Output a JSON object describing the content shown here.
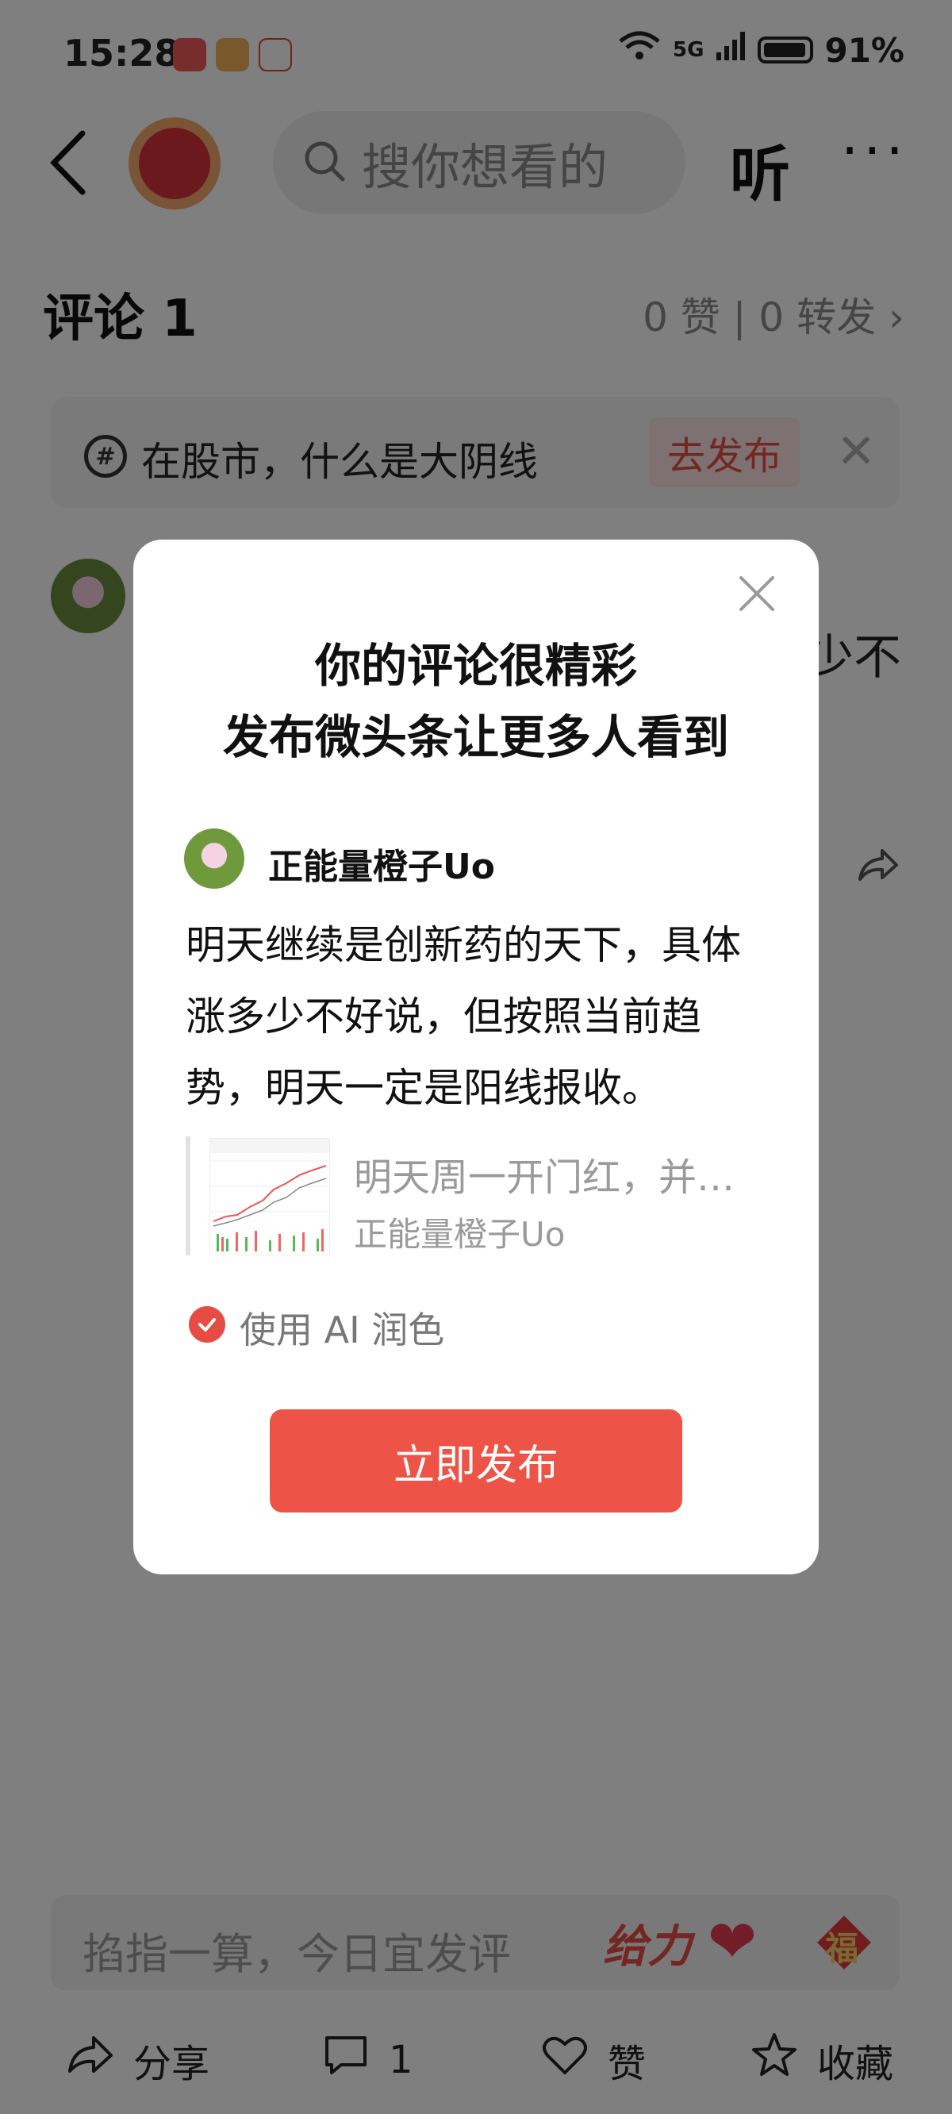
{
  "status_bar": {
    "time": "15:28",
    "network": "5G",
    "battery": "91%"
  },
  "header": {
    "search_placeholder": "搜你想看的",
    "listen_label": "听",
    "more_label": "···"
  },
  "comments": {
    "title": "评论 1",
    "stats": "0 赞 | 0 转发 ›"
  },
  "topic": {
    "text": "在股市，什么是大阴线",
    "publish_label": "去发布",
    "close": "✕"
  },
  "background_comment": {
    "partial_text": "少不"
  },
  "input": {
    "placeholder": "掐指一算，今日宜发评",
    "gift_label": "给力",
    "fu_label": "福"
  },
  "bottom_bar": {
    "share": "分享",
    "comment_count": "1",
    "like": "赞",
    "favorite": "收藏"
  },
  "modal": {
    "title_line1": "你的评论很精彩",
    "title_line2": "发布微头条让更多人看到",
    "author": "正能量橙子Uo",
    "body": "明天继续是创新药的天下，具体涨多少不好说，但按照当前趋势，明天一定是阳线报收。",
    "quote_title": "明天周一开门红，并…",
    "quote_source": "正能量橙子Uo",
    "ai_label": "使用 AI 润色",
    "publish_button": "立即发布"
  },
  "colors": {
    "accent": "#ed5347",
    "overlay": "rgba(0,0,0,0.5)"
  }
}
